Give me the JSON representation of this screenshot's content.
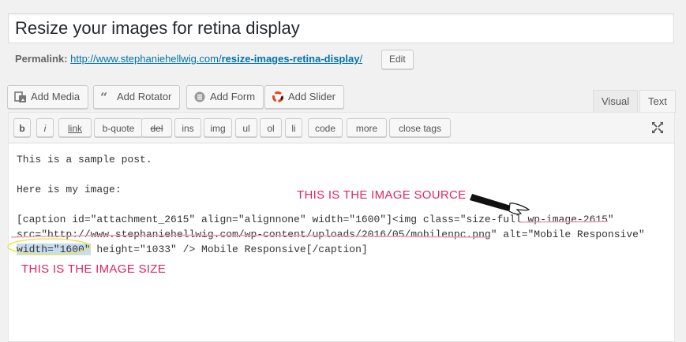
{
  "post": {
    "title": "Resize your images for retina display",
    "permalink_label": "Permalink:",
    "permalink_base": "http://www.stephaniehellwig.com/",
    "permalink_slug": "resize-images-retina-display",
    "permalink_tail": "/",
    "edit_label": "Edit"
  },
  "media_buttons": [
    {
      "label": "Add Media",
      "icon": "media-icon"
    },
    {
      "label": "Add Rotator",
      "icon": "rotator-icon"
    },
    {
      "label": "Add Form",
      "icon": "form-icon"
    },
    {
      "label": "Add Slider",
      "icon": "slider-icon"
    }
  ],
  "tabs": {
    "visual": "Visual",
    "text": "Text"
  },
  "quicktags": [
    "b",
    "i",
    "link",
    "b-quote",
    "del",
    "ins",
    "img",
    "ul",
    "ol",
    "li",
    "code",
    "more",
    "close tags"
  ],
  "content": {
    "line1": "This is a sample post.",
    "line2": "Here is my image:",
    "line3": "[caption id=\"attachment_2615\" align=\"alignnone\" width=\"1600\"]<img class=\"size-full wp-image-2615\"",
    "line4": "src=\"http://www.stephaniehellwig.com/wp-content/uploads/2016/05/mobilenpc.png\" alt=\"Mobile Responsive\"",
    "line5_highlight": "width=\"1600\"",
    "line5_rest": " height=\"1033\" /> Mobile Responsive[/caption]"
  },
  "annotations": {
    "source": "THIS IS THE IMAGE SOURCE",
    "size": "THIS IS THE IMAGE SIZE"
  },
  "colors": {
    "annotation": "#e0255e",
    "link": "#0073aa",
    "highlight": "#c8dcf0",
    "ellipse": "#e6e85a"
  }
}
